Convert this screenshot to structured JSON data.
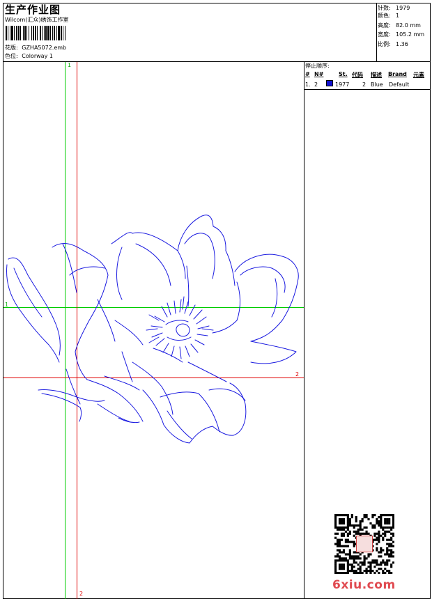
{
  "header": {
    "title": "生产作业图",
    "company": "Wilcom(汇众)绣饰工作室",
    "design_label": "花版:",
    "design_value": "GZHA5072.emb",
    "colorway_label": "色位:",
    "colorway_value": "Colorway 1"
  },
  "specs": [
    {
      "label": "针数:",
      "value": "1979"
    },
    {
      "label": "颜色:",
      "value": "1"
    },
    {
      "label": "高度:",
      "value": "82.0 mm"
    },
    {
      "label": "宽度:",
      "value": "105.2 mm"
    },
    {
      "label": "比例:",
      "value": "1.36"
    }
  ],
  "stop_sequence": {
    "title": "停止顺序:",
    "headers": [
      "#",
      "N#",
      "St.",
      "代码",
      "描述",
      "Brand",
      "元素"
    ],
    "rows": [
      {
        "index": "1.",
        "needle": "2",
        "color": "#1010d0",
        "stitches": "1977",
        "code": "2",
        "desc": "Blue",
        "brand": "Default"
      }
    ]
  },
  "guides": {
    "green_label": "1",
    "red_label": "2",
    "line_color_green": "#00cc00",
    "line_color_red": "#e00000"
  },
  "artwork": {
    "stroke_color": "#1a1ae0"
  },
  "watermark": {
    "text": "6xiu.com",
    "color": "#e04a50"
  }
}
